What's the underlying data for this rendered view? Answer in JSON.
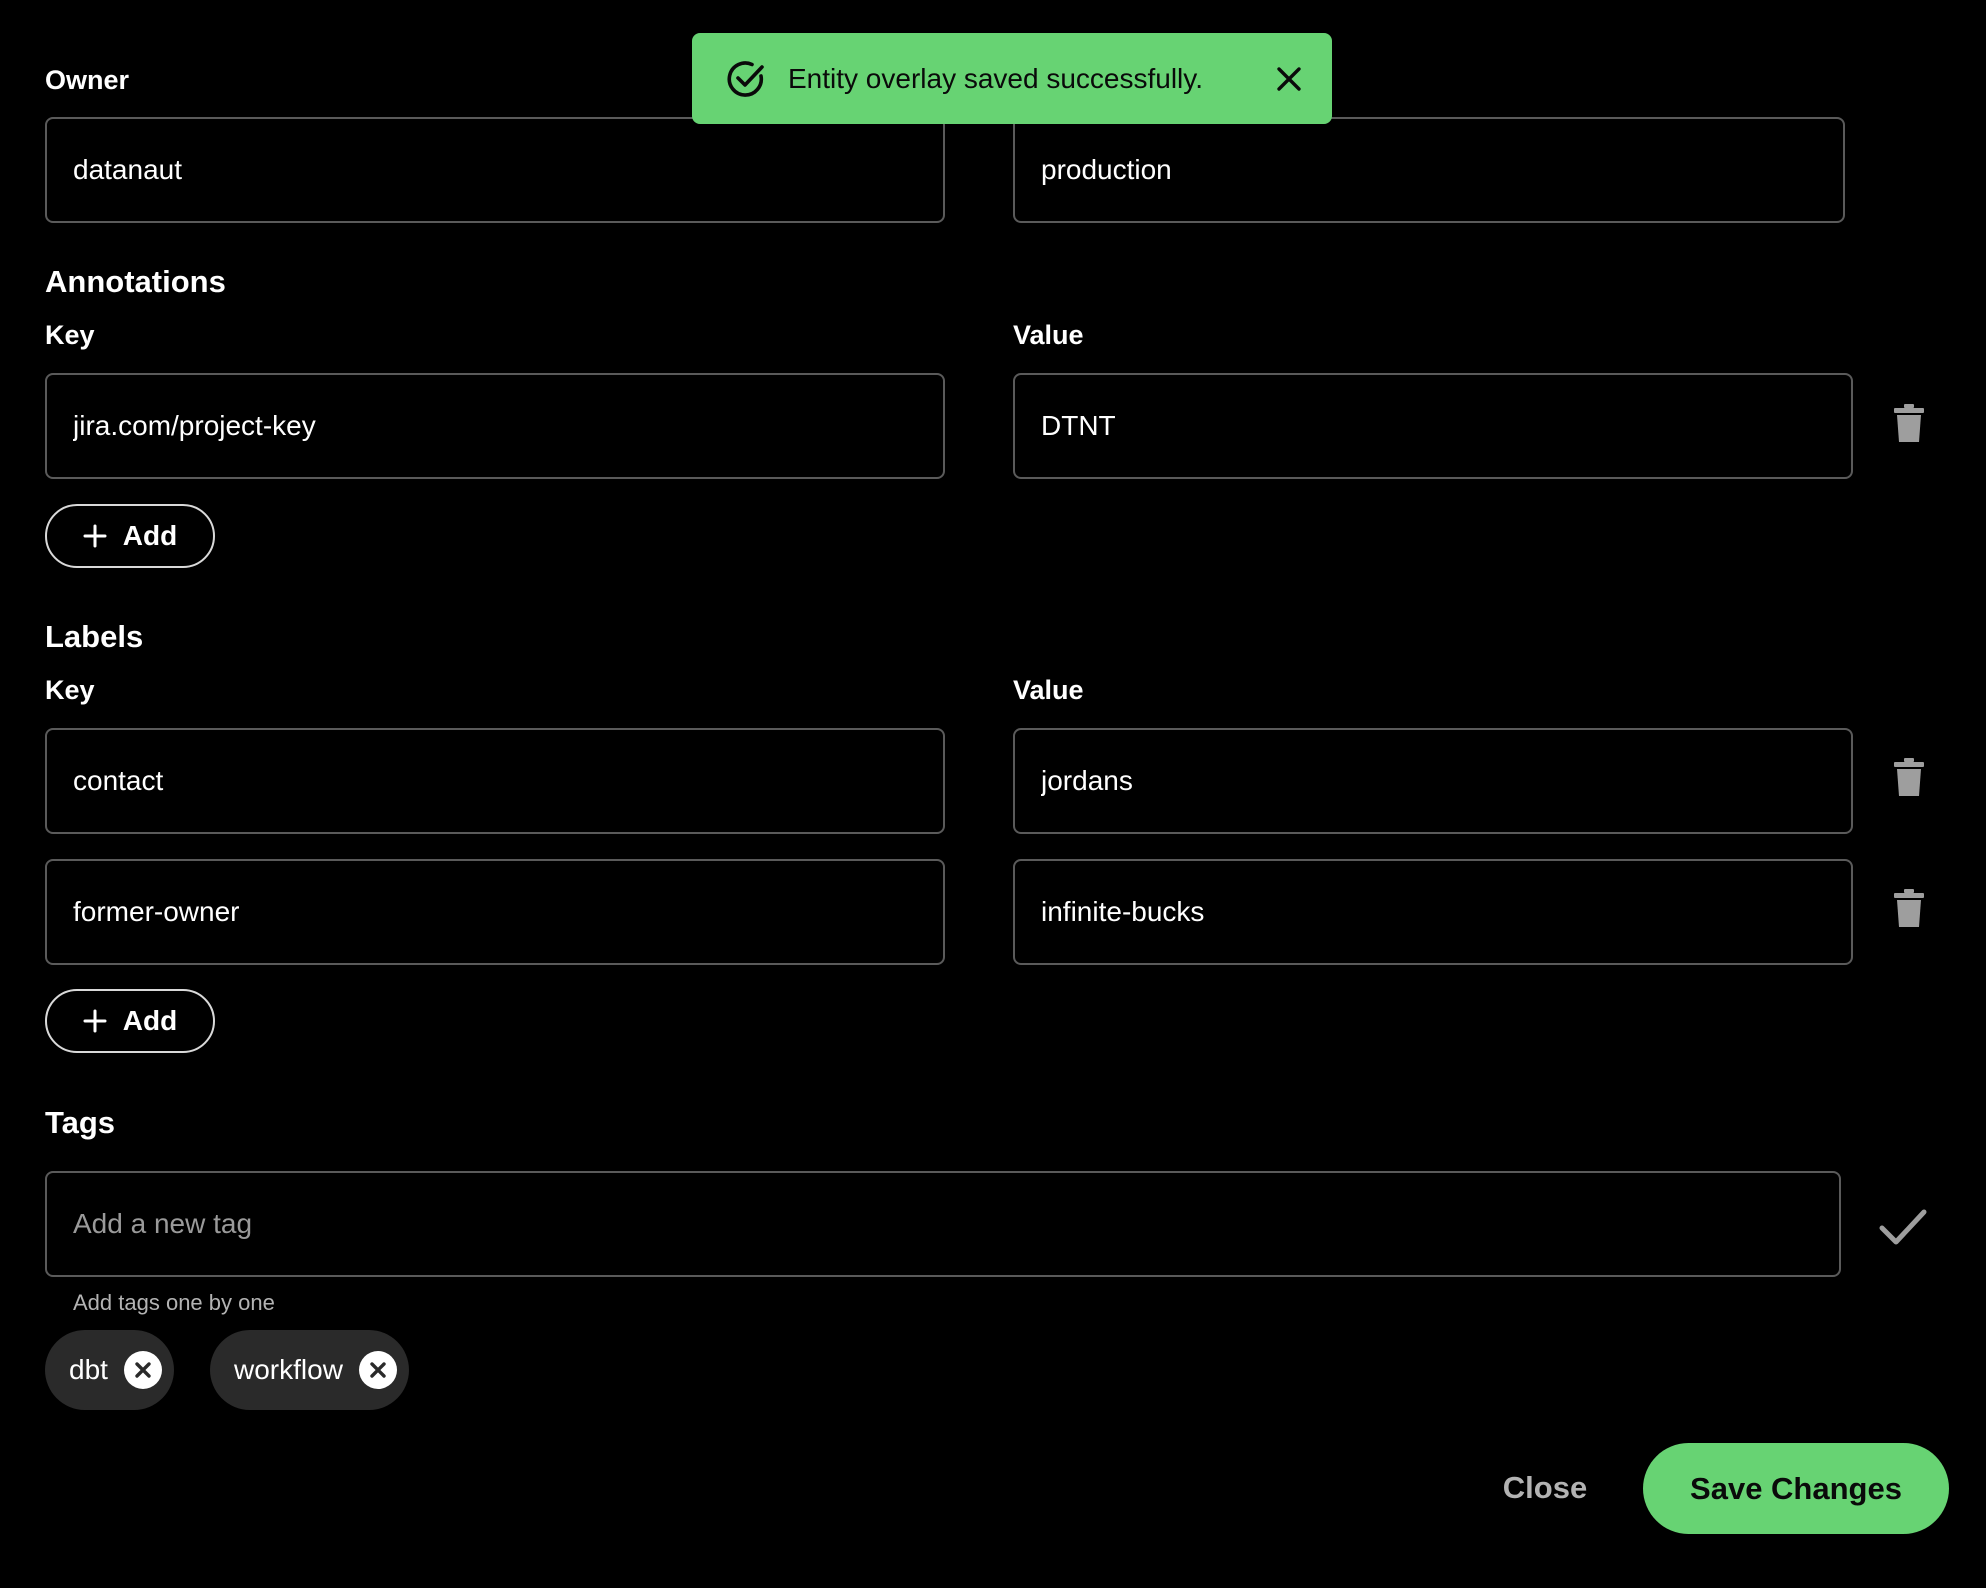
{
  "toast": {
    "message": "Entity overlay saved successfully.",
    "color": "#67d373"
  },
  "owner": {
    "label": "Owner",
    "value": "datanaut"
  },
  "lifecycle": {
    "value": "production"
  },
  "annotations": {
    "title": "Annotations",
    "key_label": "Key",
    "value_label": "Value",
    "rows": [
      {
        "key": "jira.com/project-key",
        "value": "DTNT"
      }
    ],
    "add_label": "Add"
  },
  "labels": {
    "title": "Labels",
    "key_label": "Key",
    "value_label": "Value",
    "rows": [
      {
        "key": "contact",
        "value": "jordans"
      },
      {
        "key": "former-owner",
        "value": "infinite-bucks"
      }
    ],
    "add_label": "Add"
  },
  "tags": {
    "title": "Tags",
    "placeholder": "Add a new tag",
    "helper": "Add tags one by one",
    "chips": [
      "dbt",
      "workflow"
    ]
  },
  "footer": {
    "close_label": "Close",
    "save_label": "Save Changes"
  },
  "icons": {
    "toast_status": "check-circle-icon",
    "toast_close": "close-icon",
    "delete": "trash-icon",
    "add": "plus-icon",
    "confirm": "checkmark-icon",
    "chip_remove": "close-circle-icon"
  }
}
